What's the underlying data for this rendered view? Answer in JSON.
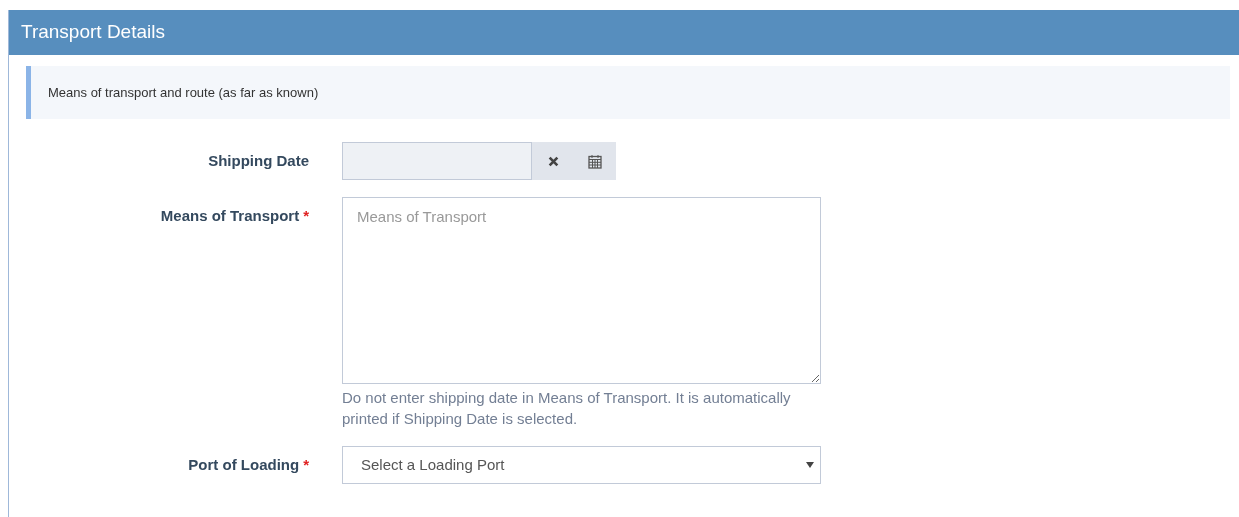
{
  "panel": {
    "title": "Transport Details"
  },
  "info": "Means of transport and route (as far as known)",
  "fields": [
    {
      "kind": "date",
      "label": "Shipping Date"
    },
    {
      "kind": "textarea",
      "label": "Means of Transport",
      "required_mark": "*",
      "placeholder": "Means of Transport",
      "help": "Do not enter shipping date in Means of Transport. It is automatically printed if Shipping Date is selected."
    },
    {
      "kind": "select",
      "label": "Port of Loading",
      "required_mark": "*",
      "placeholder": "Select a Loading Port"
    }
  ]
}
